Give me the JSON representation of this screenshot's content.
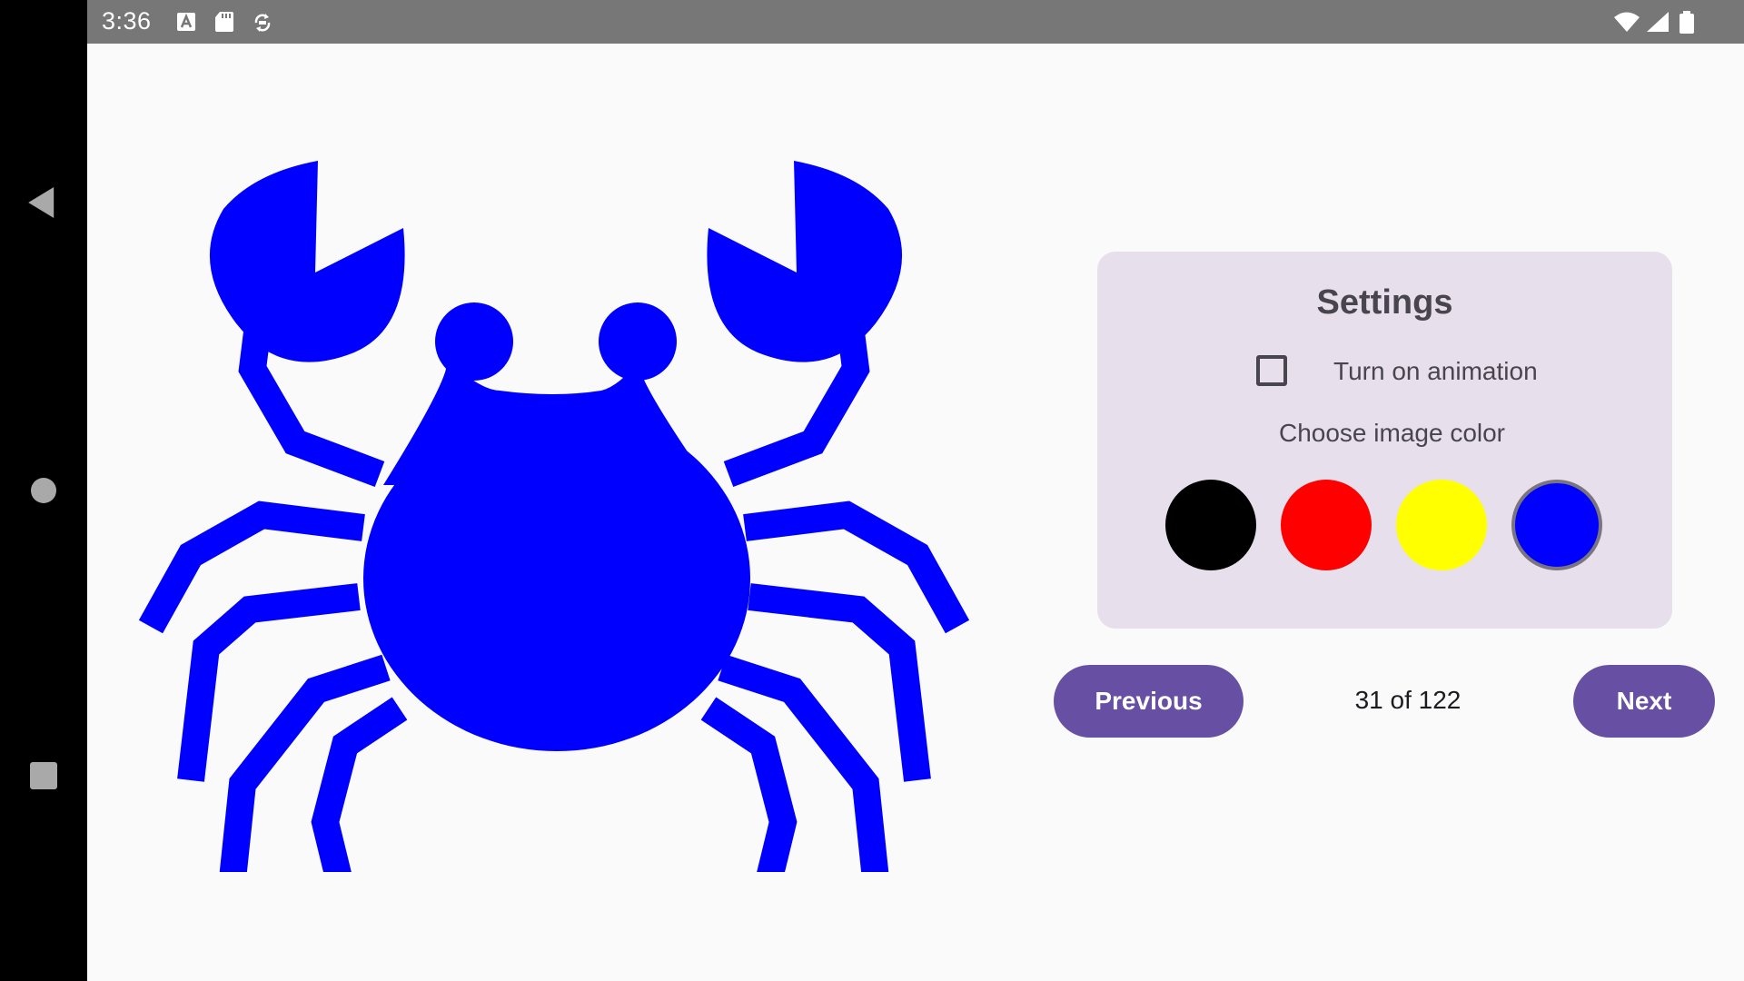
{
  "status_bar": {
    "time": "3:36",
    "left_icons": [
      "keyboard-a-icon",
      "sd-card-icon",
      "sync-icon"
    ],
    "right_icons": [
      "wifi-icon",
      "cell-signal-icon",
      "battery-icon"
    ]
  },
  "nav_bar": {
    "buttons": [
      "back-icon",
      "home-icon",
      "recents-icon"
    ]
  },
  "image": {
    "subject": "crab-icon",
    "color": "#0000ff"
  },
  "settings": {
    "title": "Settings",
    "animation_label": "Turn on animation",
    "animation_checked": false,
    "color_label": "Choose image color",
    "colors": [
      "#000000",
      "#ff0000",
      "#ffff00",
      "#0000ff"
    ],
    "selected_color": "#0000ff"
  },
  "pagination": {
    "previous_label": "Previous",
    "indicator": "31 of 122",
    "next_label": "Next"
  },
  "theme": {
    "accent": "#6750a4",
    "card_bg": "#e7e0ec"
  }
}
